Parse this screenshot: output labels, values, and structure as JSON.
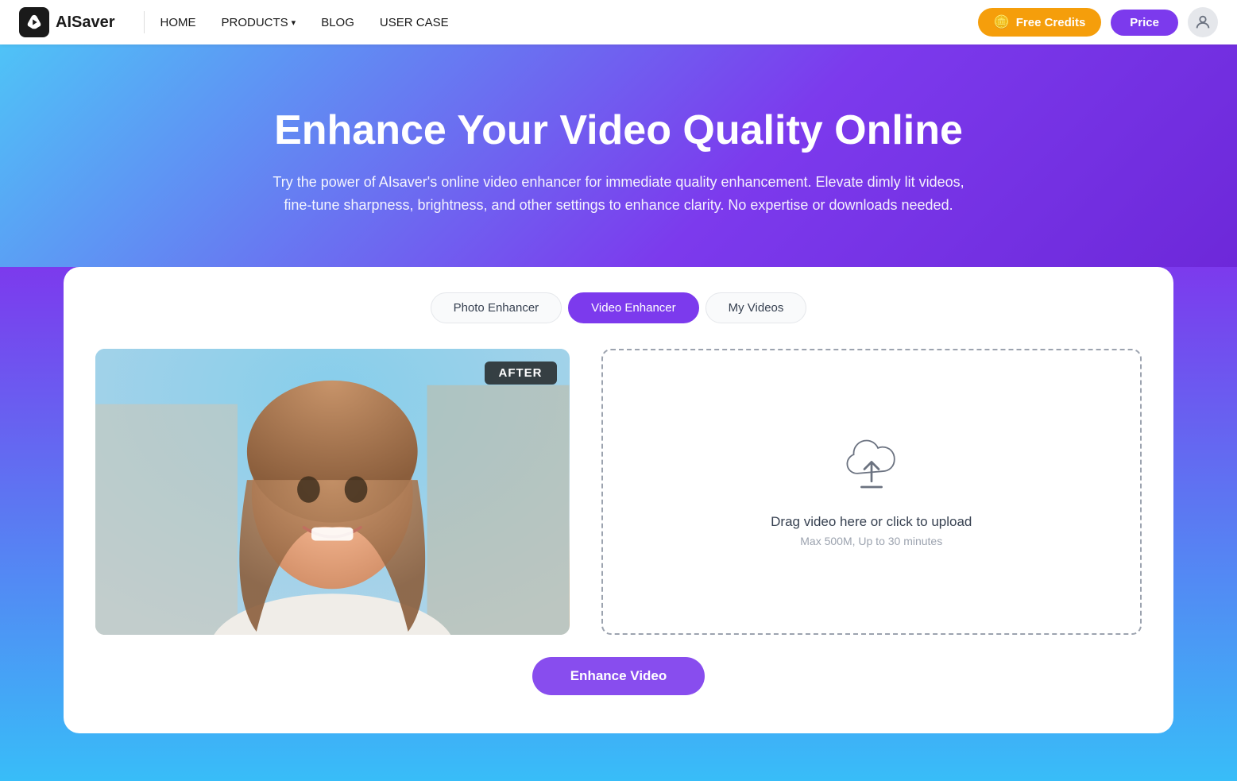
{
  "brand": {
    "name": "AISaver",
    "logo_alt": "AISaver logo"
  },
  "nav": {
    "home": "HOME",
    "products": "PRODUCTS",
    "blog": "BLOG",
    "user_case": "USER CASE"
  },
  "header_buttons": {
    "free_credits": "Free Credits",
    "price": "Price"
  },
  "hero": {
    "title": "Enhance Your Video Quality Online",
    "subtitle": "Try the power of AIsaver's online video enhancer for immediate quality enhancement. Elevate dimly lit videos, fine-tune sharpness, brightness, and other settings to enhance clarity. No expertise or downloads needed."
  },
  "tabs": [
    {
      "id": "photo",
      "label": "Photo Enhancer",
      "active": false
    },
    {
      "id": "video",
      "label": "Video Enhancer",
      "active": true
    },
    {
      "id": "myvideos",
      "label": "My Videos",
      "active": false
    }
  ],
  "image_preview": {
    "badge": "AFTER"
  },
  "upload": {
    "main_text": "Drag video here or click to upload",
    "sub_text": "Max 500M, Up to 30 minutes"
  },
  "enhance_button": {
    "label": "Enhance Video"
  }
}
